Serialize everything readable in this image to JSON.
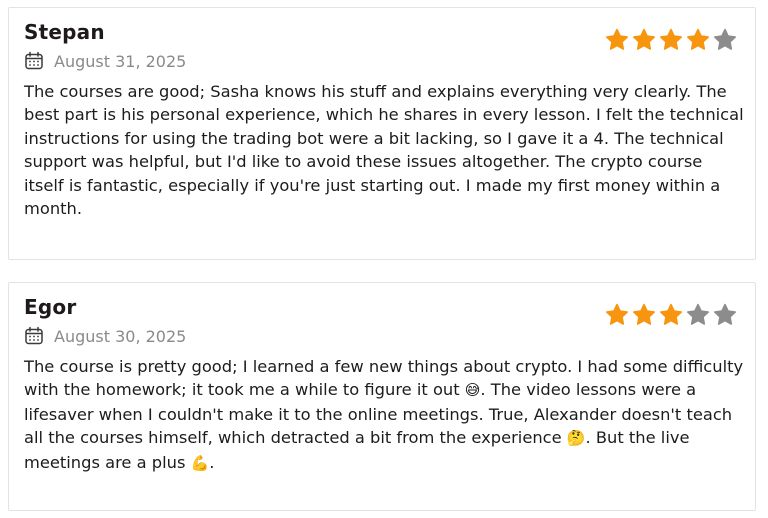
{
  "reviews": [
    {
      "name": "Stepan",
      "date": "August 31, 2025",
      "rating": 4,
      "max_rating": 5,
      "text": "The courses are good; Sasha knows his stuff and explains everything very clearly. The best part is his personal experience, which he shares in every lesson. I felt the technical instructions for using the trading bot were a bit lacking, so I gave it a 4. The technical support was helpful, but I'd like to avoid these issues altogether. The crypto course itself is fantastic, especially if you're just starting out. I made my first money within a month."
    },
    {
      "name": "Egor",
      "date": "August 30, 2025",
      "rating": 3,
      "max_rating": 5,
      "text_parts": [
        "The course is pretty good; I learned a few new things about crypto. I had some difficulty with the homework; it took me a while to figure it out ",
        "😅",
        ". The video lessons were a lifesaver when I couldn't make it to the online meetings. True, Alexander doesn't teach all the courses himself, which detracted a bit from the experience ",
        "🤔",
        ". But the live meetings are a plus ",
        "💪",
        "."
      ]
    }
  ],
  "colors": {
    "star_filled": "#f7950f",
    "star_empty": "#8c8c8c",
    "border": "#e3e3e3",
    "date_text": "#8a8a8a"
  },
  "icons": {
    "date_icon": "calendar-icon",
    "rating_icon": "star-icon"
  }
}
